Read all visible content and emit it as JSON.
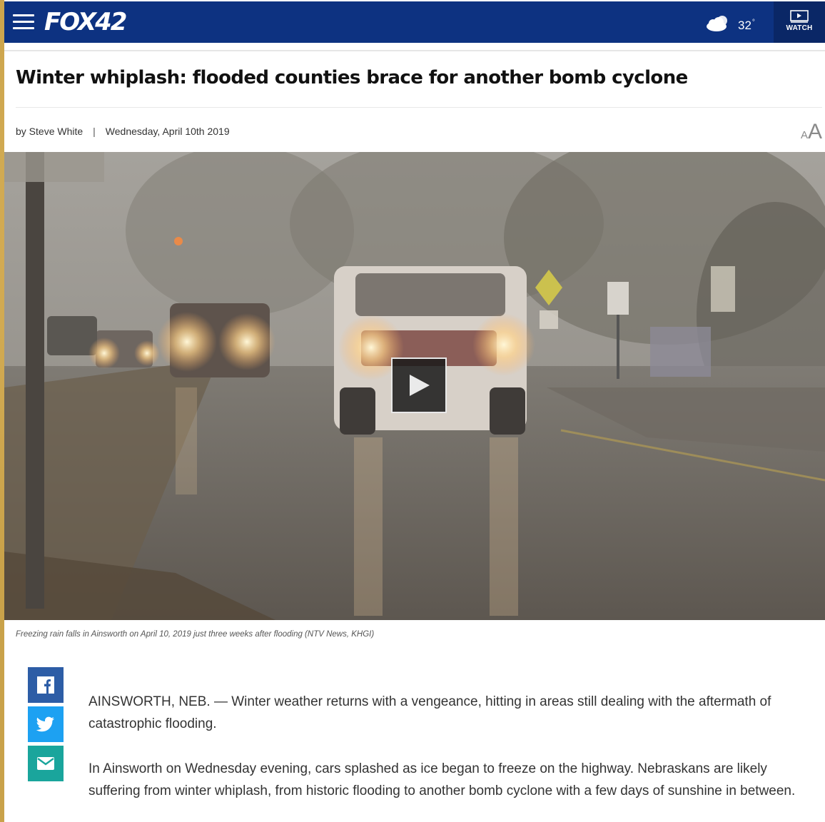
{
  "header": {
    "logo": "FOX42",
    "weather_icon": "partly-cloudy-icon",
    "temperature": "32",
    "degree": "°",
    "watch_label": "WATCH",
    "bar_color": "#0d3281"
  },
  "article": {
    "headline": "Winter whiplash: flooded counties brace for another bomb cyclone",
    "author": "by Steve White",
    "divider": "|",
    "date": "Wednesday, April 10th 2019",
    "text_size_small": "A",
    "text_size_large": "A",
    "caption": "Freezing rain falls in Ainsworth on April 10, 2019 just three weeks after flooding (NTV News, KHGI)",
    "paragraphs": [
      "AINSWORTH, NEB. — Winter weather returns with a vengeance, hitting in areas still dealing with the aftermath of catastrophic flooding.",
      "In Ainsworth on Wednesday evening, cars splashed as ice began to freeze on the highway. Nebraskans are likely suffering from winter whiplash, from historic flooding to another bomb cyclone with a few days of sunshine in between."
    ]
  },
  "share": {
    "facebook_icon": "facebook-icon",
    "twitter_icon": "twitter-icon",
    "email_icon": "email-icon"
  }
}
